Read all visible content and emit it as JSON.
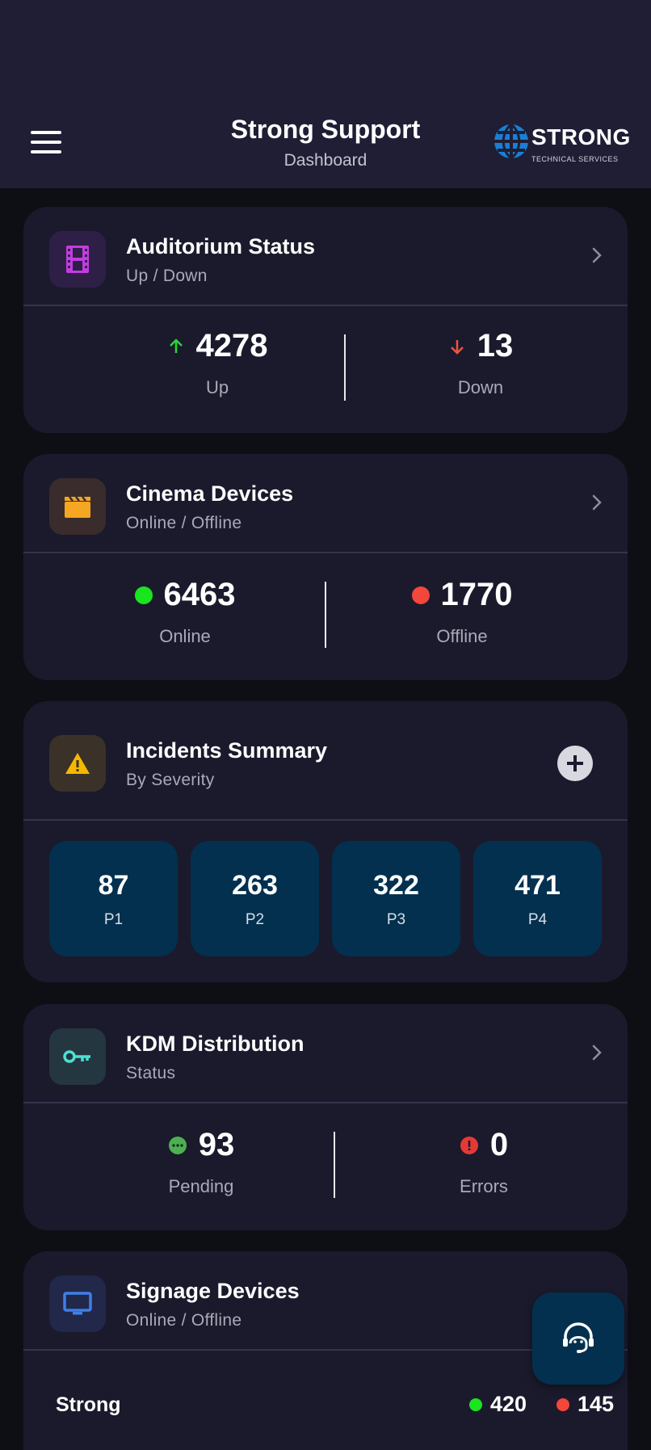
{
  "header": {
    "title": "Strong Support",
    "subtitle": "Dashboard",
    "logo_text": "STRONG",
    "logo_sub": "TECHNICAL SERVICES"
  },
  "colors": {
    "up": "#2bd43a",
    "down": "#f0533f",
    "online": "#19e51f",
    "offline": "#f2473a",
    "pending": "#4caf50",
    "error": "#e53935",
    "severity_tile": "#03304f"
  },
  "auditorium": {
    "title": "Auditorium Status",
    "subtitle": "Up / Down",
    "icon": "film-icon",
    "up_value": "4278",
    "up_label": "Up",
    "down_value": "13",
    "down_label": "Down"
  },
  "cinema": {
    "title": "Cinema Devices",
    "subtitle": "Online / Offline",
    "icon": "clapperboard-icon",
    "online_value": "6463",
    "online_label": "Online",
    "offline_value": "1770",
    "offline_label": "Offline"
  },
  "incidents": {
    "title": "Incidents Summary",
    "subtitle": "By Severity",
    "icon": "warning-icon",
    "severities": [
      {
        "value": "87",
        "label": "P1"
      },
      {
        "value": "263",
        "label": "P2"
      },
      {
        "value": "322",
        "label": "P3"
      },
      {
        "value": "471",
        "label": "P4"
      }
    ]
  },
  "kdm": {
    "title": "KDM Distribution",
    "subtitle": "Status",
    "icon": "key-icon",
    "pending_value": "93",
    "pending_label": "Pending",
    "errors_value": "0",
    "errors_label": "Errors"
  },
  "signage": {
    "title": "Signage Devices",
    "subtitle": "Online / Offline",
    "icon": "monitor-icon",
    "rows": [
      {
        "name": "Strong",
        "online": "420",
        "offline": "145"
      }
    ]
  },
  "fab": {
    "icon": "support-agent-icon"
  }
}
